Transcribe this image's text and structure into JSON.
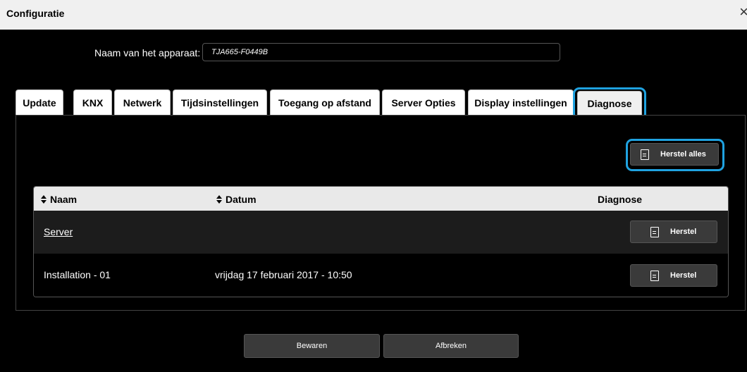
{
  "window": {
    "title": "Configuratie",
    "close_glyph": "×"
  },
  "device": {
    "label": "Naam van het apparaat:",
    "value": "TJA665-F0449B"
  },
  "tabs": [
    {
      "label": "Update"
    },
    {
      "label": "KNX"
    },
    {
      "label": "Netwerk"
    },
    {
      "label": "Tijdsinstellingen"
    },
    {
      "label": "Toegang op afstand"
    },
    {
      "label": "Server Opties"
    },
    {
      "label": "Display instellingen"
    },
    {
      "label": "Diagnose",
      "active": true
    }
  ],
  "diagnose": {
    "restore_all_label": "Herstel alles",
    "table": {
      "headers": {
        "name": "Naam",
        "date": "Datum",
        "diagnose": "Diagnose"
      },
      "rows": [
        {
          "name": "Server",
          "date": "",
          "action": "Herstel"
        },
        {
          "name": "Installation - 01",
          "date": "vrijdag 17 februari 2017 - 10:50",
          "action": "Herstel"
        }
      ]
    }
  },
  "footer": {
    "save_label": "Bewaren",
    "cancel_label": "Afbreken"
  },
  "colors": {
    "highlight": "#1fa2e0",
    "background": "#000000",
    "button": "#3a3a3a"
  },
  "icons": {
    "document": "document-icon",
    "sort": "sort-icon",
    "close": "close-icon"
  }
}
